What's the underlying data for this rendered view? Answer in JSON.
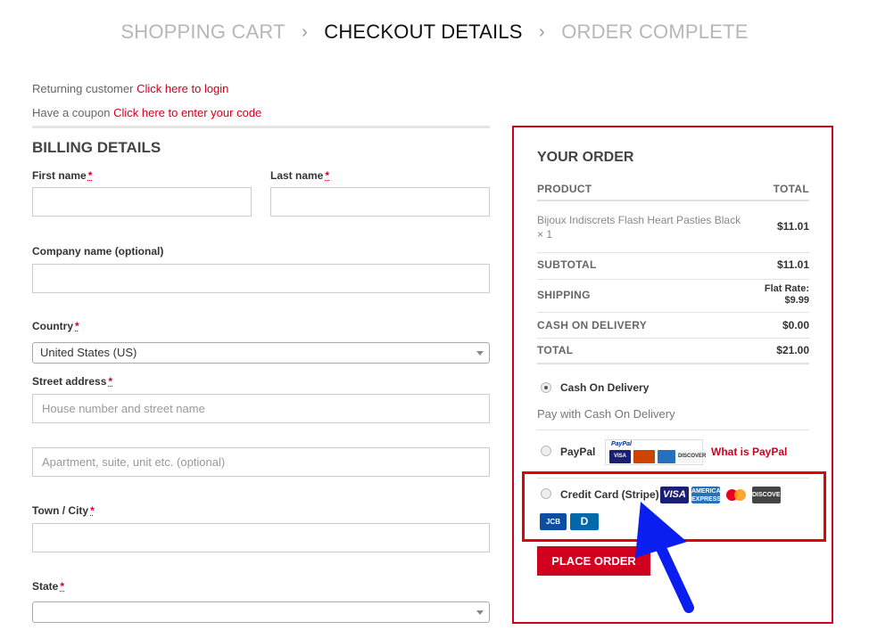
{
  "steps": {
    "step1": "SHOPPING CART",
    "sep": "›",
    "step2": "CHECKOUT DETAILS",
    "step3": "ORDER COMPLETE"
  },
  "notices": {
    "returning_text": "Returning customer",
    "returning_link": "Click here to login",
    "coupon_text": "Have a coupon",
    "coupon_link": "Click here to enter your code"
  },
  "billing": {
    "title": "BILLING DETAILS",
    "required_mark": "*",
    "first_name_label": "First name",
    "last_name_label": "Last name",
    "company_label": "Company name (optional)",
    "country_label": "Country",
    "country_value": "United States (US)",
    "street_label": "Street address",
    "street_placeholder": "House number and street name",
    "apartment_placeholder": "Apartment, suite, unit etc. (optional)",
    "city_label": "Town / City",
    "state_label": "State"
  },
  "order": {
    "title": "YOUR ORDER",
    "col_product": "PRODUCT",
    "col_total": "TOTAL",
    "product_name": "Bijoux Indiscrets Flash Heart Pasties Black × 1",
    "product_total": "$11.01",
    "subtotal_label": "SUBTOTAL",
    "subtotal_value": "$11.01",
    "shipping_label": "SHIPPING",
    "shipping_value_1": "Flat Rate:",
    "shipping_value_2": "$9.99",
    "cod_label": "CASH ON DELIVERY",
    "cod_value": "$0.00",
    "total_label": "TOTAL",
    "total_value": "$21.00"
  },
  "payment": {
    "cod_label": "Cash On Delivery",
    "cod_desc": "Pay with Cash On Delivery",
    "paypal_label": "PayPal",
    "paypal_badge_text": "PayPal",
    "what_is_paypal": "What is PayPal",
    "stripe_label": "Credit Card (Stripe)",
    "selected": "Cash On Delivery",
    "card_visa": "VISA",
    "card_amex": "AMERICAN EXPRESS",
    "card_discover": "DISCOVER",
    "card_jcb": "JCB",
    "card_diners": "D"
  },
  "place_order_label": "PLACE ORDER",
  "colors": {
    "accent": "#d2001f",
    "highlight_box": "#e60000",
    "arrow": "#0a1ef0"
  }
}
